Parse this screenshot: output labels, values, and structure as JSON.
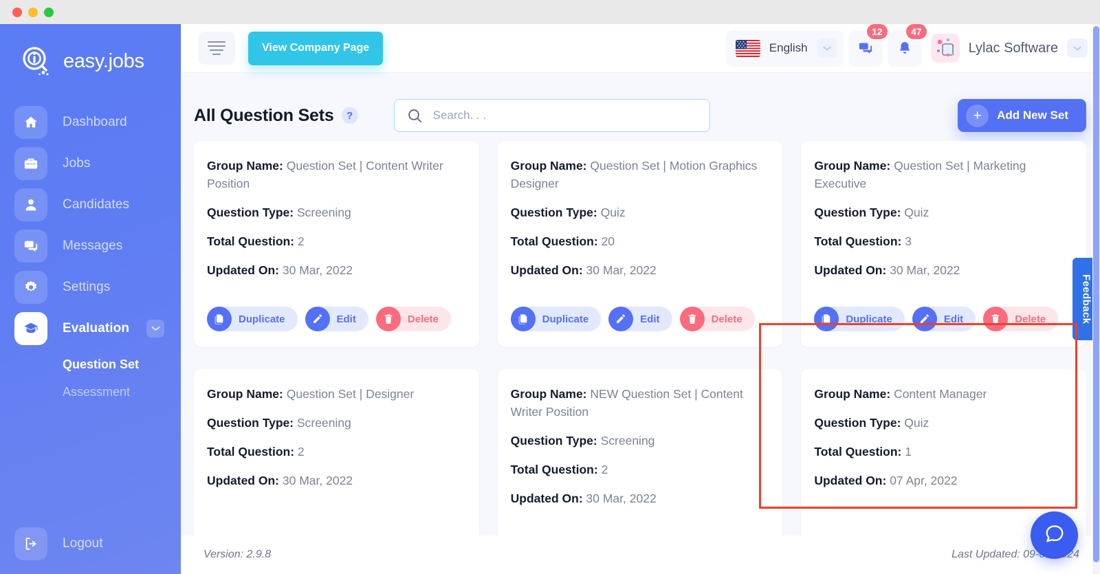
{
  "window": {
    "title_dots": [
      "red",
      "yellow",
      "green"
    ]
  },
  "sidebar": {
    "brand": "easy.jobs",
    "items": [
      {
        "label": "Dashboard",
        "icon": "home-icon",
        "active": false
      },
      {
        "label": "Jobs",
        "icon": "briefcase-icon",
        "active": false
      },
      {
        "label": "Candidates",
        "icon": "user-icon",
        "active": false
      },
      {
        "label": "Messages",
        "icon": "chat-icon",
        "active": false
      },
      {
        "label": "Settings",
        "icon": "gear-icon",
        "active": false
      },
      {
        "label": "Evaluation",
        "icon": "graduation-cap-icon",
        "active": true
      }
    ],
    "subitems": [
      {
        "label": "Question Set",
        "active": true
      },
      {
        "label": "Assessment",
        "active": false
      }
    ],
    "logout": {
      "label": "Logout",
      "icon": "logout-icon"
    }
  },
  "topbar": {
    "menu_icon": "hamburger-icon",
    "company_button": "View Company Page",
    "language": {
      "value": "English",
      "flag": "us-flag-icon",
      "chevron": "chevron-down-icon"
    },
    "messages": {
      "icon": "chat-icon",
      "badge": "12"
    },
    "notifications": {
      "icon": "bell-icon",
      "badge": "47"
    },
    "user": {
      "name": "Lylac Software",
      "avatar": "user-avatar",
      "chevron": "chevron-down-icon"
    }
  },
  "page": {
    "title": "All Question Sets",
    "help_icon": "question-mark-icon",
    "search": {
      "value": "",
      "placeholder": "Search. . .",
      "icon": "search-icon"
    },
    "add_button": {
      "label": "Add New Set",
      "icon": "plus-icon"
    }
  },
  "labels": {
    "group_name": "Group Name:",
    "question_type": "Question Type:",
    "total_question": "Total Question:",
    "updated_on": "Updated On:",
    "duplicate": "Duplicate",
    "edit": "Edit",
    "delete": "Delete"
  },
  "cards": [
    {
      "group_name": "Question Set | Content Writer Position",
      "question_type": "Screening",
      "total_question": "2",
      "updated_on": "30 Mar, 2022",
      "highlighted": false
    },
    {
      "group_name": "Question Set | Motion Graphics Designer",
      "question_type": "Quiz",
      "total_question": "20",
      "updated_on": "30 Mar, 2022",
      "highlighted": false
    },
    {
      "group_name": "Question Set | Marketing Executive",
      "question_type": "Quiz",
      "total_question": "3",
      "updated_on": "30 Mar, 2022",
      "highlighted": false
    },
    {
      "group_name": "Question Set | Designer",
      "question_type": "Screening",
      "total_question": "2",
      "updated_on": "30 Mar, 2022",
      "highlighted": false
    },
    {
      "group_name": "NEW Question Set | Content Writer Position",
      "question_type": "Screening",
      "total_question": "2",
      "updated_on": "30 Mar, 2022",
      "highlighted": false
    },
    {
      "group_name": "Content Manager",
      "question_type": "Quiz",
      "total_question": "1",
      "updated_on": "07 Apr, 2022",
      "highlighted": true
    }
  ],
  "footer": {
    "version": "Version: 2.9.8",
    "last_updated": "Last Updated: 09-04-2024"
  },
  "floating": {
    "feedback_tab": "Feedback",
    "chat_icon": "chat-bubble-icon"
  },
  "colors": {
    "sidebar": "#5f7df3",
    "accent_blue": "#5471f5",
    "cyan": "#31c5e8",
    "red": "#fb6b7e",
    "highlight_border": "#f0402a",
    "feedback": "#2f72e8"
  }
}
